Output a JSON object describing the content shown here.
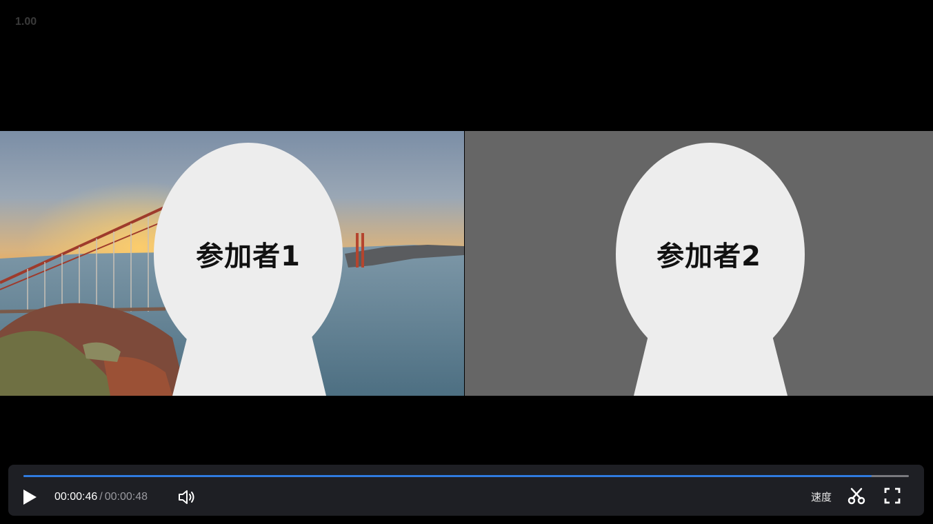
{
  "viewer": {
    "zoom_level": "1.00"
  },
  "participants": [
    {
      "label": "参加者1",
      "background": "photo-golden-gate-bridge"
    },
    {
      "label": "参加者2",
      "background": "#666666"
    }
  ],
  "player": {
    "progress_fraction": 0.958,
    "current_time": "00:00:46",
    "separator": "/",
    "total_time": "00:00:48",
    "speed_label": "速度",
    "accent_color": "#2f7be0",
    "icons": {
      "play": "play-icon",
      "volume": "volume-icon",
      "cut": "scissors-icon",
      "fullscreen": "fullscreen-icon"
    }
  }
}
